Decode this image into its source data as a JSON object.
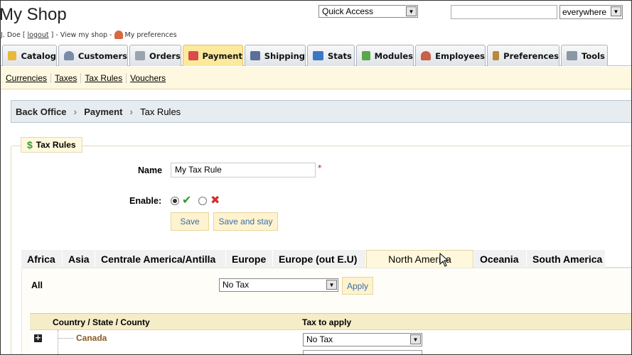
{
  "header": {
    "shop_title": "My Shop",
    "user_prefix": "J. Doe [",
    "logout": "logout",
    "user_suffix": "] - View my shop -",
    "preferences": "My preferences",
    "quick_access": "Quick Access",
    "search_value": "",
    "search_scope": "everywhere"
  },
  "tabs": [
    {
      "label": "Catalog",
      "color": "#e8b93a"
    },
    {
      "label": "Customers",
      "color": "#7a8aa8"
    },
    {
      "label": "Orders",
      "color": "#9aa3ad"
    },
    {
      "label": "Payment",
      "color": "#d84c4c"
    },
    {
      "label": "Shipping",
      "color": "#5a6f9a"
    },
    {
      "label": "Stats",
      "color": "#3b78c4"
    },
    {
      "label": "Modules",
      "color": "#5aa84a"
    },
    {
      "label": "Employees",
      "color": "#c8604a"
    },
    {
      "label": "Preferences",
      "color": "#b88a3a"
    },
    {
      "label": "Tools",
      "color": "#8a97a5"
    }
  ],
  "subnav": [
    "Currencies",
    "Taxes",
    "Tax Rules",
    "Vouchers"
  ],
  "breadcrumb": [
    "Back Office",
    "Payment",
    "Tax Rules"
  ],
  "form": {
    "legend": "Tax Rules",
    "name_label": "Name",
    "name_value": "My Tax Rule",
    "required_mark": "*",
    "enable_label": "Enable:",
    "save": "Save",
    "save_stay": "Save and stay"
  },
  "zones": [
    "Africa",
    "Asia",
    "Centrale America/Antilla",
    "Europe",
    "Europe (out E.U)",
    "North America",
    "Oceania",
    "South America"
  ],
  "zone_active": "North America",
  "panel": {
    "all_label": "All",
    "all_value": "No Tax",
    "apply": "Apply",
    "col_country": "Country / State / County",
    "col_tax": "Tax to apply",
    "row_country": "Canada",
    "row_value": "No Tax"
  }
}
